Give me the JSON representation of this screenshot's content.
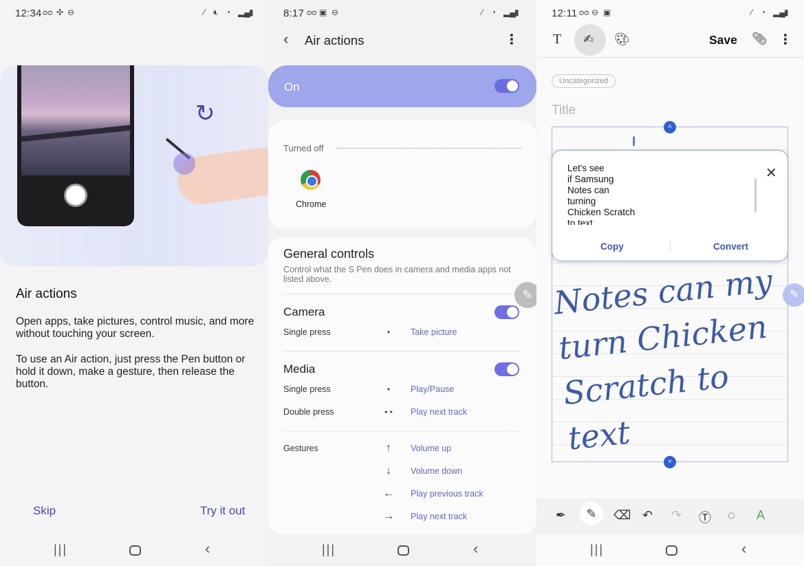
{
  "panel1": {
    "status": {
      "time": "12:34"
    },
    "title": "Air actions",
    "description": "Open apps, take pictures, control music, and more without touching your screen.",
    "instructions": "To use an Air action, just press the Pen button or hold it down, make a gesture, then release the button.",
    "skip_label": "Skip",
    "try_label": "Try it out"
  },
  "panel2": {
    "status": {
      "time": "8:17"
    },
    "title": "Air actions",
    "master_toggle": {
      "label": "On",
      "on": true
    },
    "turned_off_label": "Turned off",
    "apps_off": [
      {
        "name": "Chrome",
        "icon": "chrome-icon"
      }
    ],
    "general": {
      "title": "General controls",
      "description": "Control what the S Pen does in camera and media apps not listed above."
    },
    "camera": {
      "title": "Camera",
      "on": true,
      "single_press_label": "Single press",
      "single_press_action": "Take picture",
      "single_gesture": "•"
    },
    "media": {
      "title": "Media",
      "on": true,
      "single_press_label": "Single press",
      "single_press_action": "Play/Pause",
      "single_gesture": "•",
      "double_press_label": "Double press",
      "double_press_action": "Play next track",
      "double_gesture": "• •"
    },
    "gestures": {
      "label": "Gestures",
      "items": [
        {
          "symbol": "↑",
          "action": "Volume up"
        },
        {
          "symbol": "↓",
          "action": "Volume down"
        },
        {
          "symbol": "←",
          "action": "Play previous track"
        },
        {
          "symbol": "→",
          "action": "Play next track"
        }
      ]
    }
  },
  "panel3": {
    "status": {
      "time": "12:11"
    },
    "save_label": "Save",
    "category": "Uncategorized",
    "title_placeholder": "Title",
    "converted_text": "Let's see\nif Samsung\nNotes can\nturning\nChicken Scratch\nto text",
    "copy_label": "Copy",
    "convert_label": "Convert",
    "handwriting": "Notes can my turn Chicken Scratch to text"
  }
}
